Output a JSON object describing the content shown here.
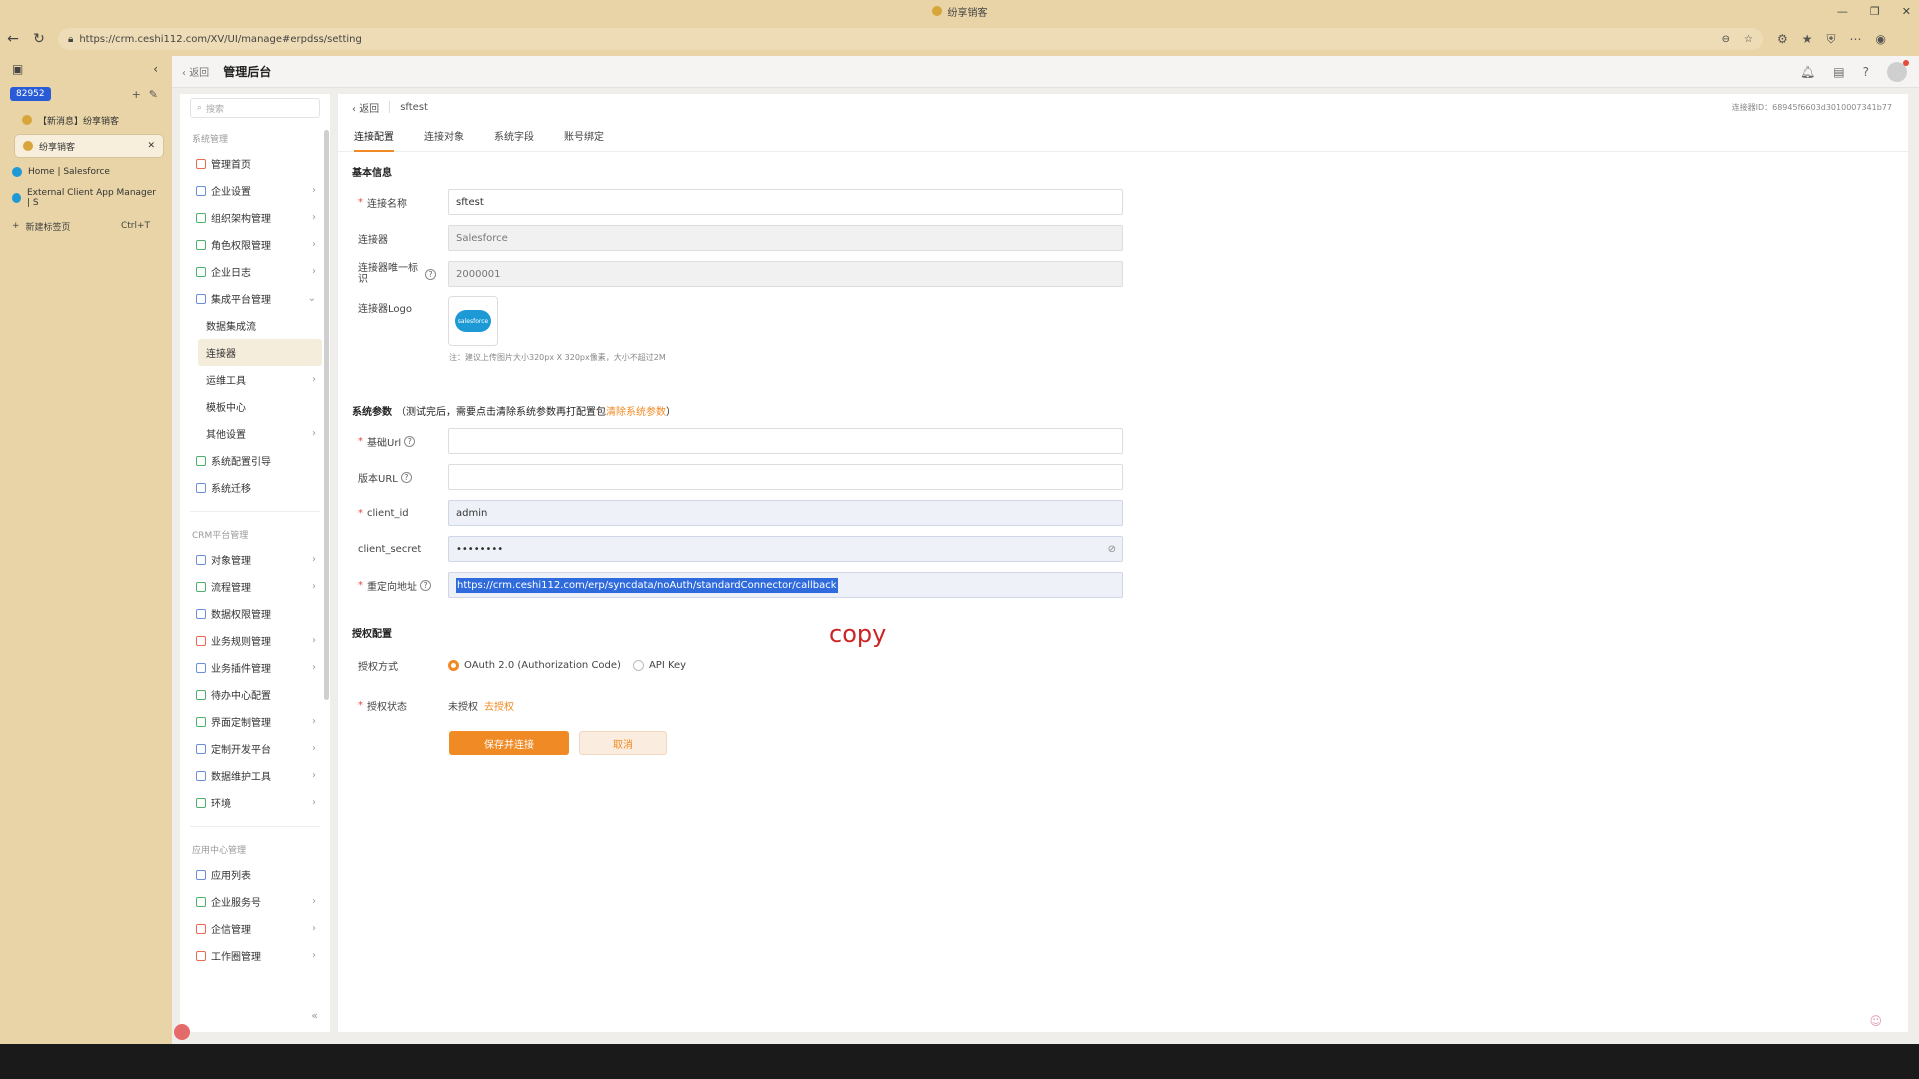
{
  "window": {
    "title": "纷享销客",
    "controls": [
      "—",
      "❐",
      "✕"
    ]
  },
  "address": {
    "url": "https://crm.ceshi112.com/XV/UI/manage#erpdss/setting"
  },
  "browser_sidebar": {
    "workspace": "82952",
    "tabs": [
      {
        "label": "【新消息】纷享销客"
      },
      {
        "label": "纷享销客"
      },
      {
        "label": "Home | Salesforce"
      },
      {
        "label": "External Client App Manager | S"
      }
    ],
    "new_tab": {
      "label": "新建标签页",
      "shortcut": "Ctrl+T"
    }
  },
  "app_header": {
    "back": "返回",
    "title": "管理后台"
  },
  "admin_menu": {
    "search_placeholder": "搜索",
    "sections": [
      {
        "title": "系统管理"
      },
      {
        "title": "CRM平台管理"
      },
      {
        "title": "应用中心管理"
      }
    ],
    "sys_items": [
      {
        "label": "管理首页"
      },
      {
        "label": "企业设置"
      },
      {
        "label": "组织架构管理"
      },
      {
        "label": "角色权限管理"
      },
      {
        "label": "企业日志"
      },
      {
        "label": "集成平台管理"
      }
    ],
    "sub_items": [
      {
        "label": "数据集成流"
      },
      {
        "label": "连接器"
      },
      {
        "label": "运维工具"
      },
      {
        "label": "模板中心"
      },
      {
        "label": "其他设置"
      }
    ],
    "sys_items2": [
      {
        "label": "系统配置引导"
      },
      {
        "label": "系统迁移"
      }
    ],
    "crm_items": [
      {
        "label": "对象管理"
      },
      {
        "label": "流程管理"
      },
      {
        "label": "数据权限管理"
      },
      {
        "label": "业务规则管理"
      },
      {
        "label": "业务插件管理"
      },
      {
        "label": "待办中心配置"
      },
      {
        "label": "界面定制管理"
      },
      {
        "label": "定制开发平台"
      },
      {
        "label": "数据维护工具"
      },
      {
        "label": "环境"
      }
    ],
    "app_items": [
      {
        "label": "应用列表"
      },
      {
        "label": "企业服务号"
      },
      {
        "label": "企信管理"
      },
      {
        "label": "工作圈管理"
      }
    ]
  },
  "content": {
    "back": "返回",
    "name": "sftest",
    "connection_id": "连接器ID：68945f6603d3010007341b77",
    "tabs": [
      "连接配置",
      "连接对象",
      "系统字段",
      "账号绑定"
    ],
    "basic_title": "基本信息",
    "fields": {
      "name_label": "连接名称",
      "name_value": "sftest",
      "connector_label": "连接器",
      "connector_value": "Salesforce",
      "uid_label": "连接器唯一标识",
      "uid_value": "2000001",
      "logo_label": "连接器Logo",
      "logo_text": "salesforce",
      "logo_hint": "注：建议上传图片大小320px X 320px像素，大小不超过2M"
    },
    "sys_params": {
      "title": "系统参数",
      "note": "（测试完后，需要点击清除系统参数再打配置包",
      "clear_link": "清除系统参数",
      "note_end": "）",
      "base_url_label": "基础Url",
      "version_url_label": "版本URL",
      "client_id_label": "client_id",
      "client_id_value": "admin",
      "client_secret_label": "client_secret",
      "client_secret_value": "••••••••",
      "redirect_label": "重定向地址",
      "redirect_value": "https://crm.ceshi112.com/erp/syncdata/noAuth/standardConnector/callback"
    },
    "annotation": "copy",
    "auth": {
      "title": "授权配置",
      "mode_label": "授权方式",
      "mode_options": [
        "OAuth 2.0 (Authorization Code)",
        "API Key"
      ],
      "selected": "OAuth 2.0 (Authorization Code)",
      "status_label": "授权状态",
      "status_value": "未授权",
      "status_link": "去授权"
    },
    "buttons": {
      "save": "保存并连接",
      "cancel": "取消"
    }
  }
}
